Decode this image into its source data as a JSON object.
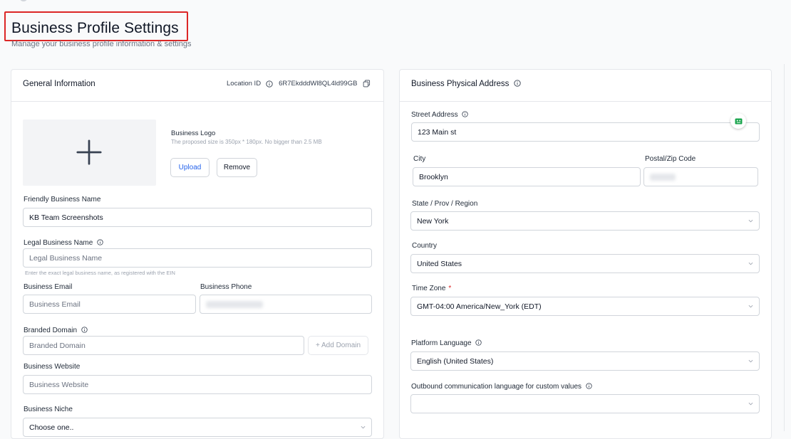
{
  "page": {
    "title": "Business Profile Settings",
    "subtitle": "Manage your business profile information & settings"
  },
  "general": {
    "title": "General Information",
    "location_label": "Location ID",
    "location_id": "6R7EkdddWl8QL4ld99GB",
    "logo_label": "Business Logo",
    "logo_hint": "The proposed size is 350px * 180px. No bigger than 2.5 MB",
    "upload_label": "Upload",
    "remove_label": "Remove",
    "friendly_name_label": "Friendly Business Name",
    "friendly_name_value": "KB Team Screenshots",
    "legal_name_label": "Legal Business Name",
    "legal_name_placeholder": "Legal Business Name",
    "legal_name_hint": "Enter the exact legal business name, as registered with the EIN",
    "email_label": "Business Email",
    "email_placeholder": "Business Email",
    "phone_label": "Business Phone",
    "domain_label": "Branded Domain",
    "domain_placeholder": "Branded Domain",
    "add_domain_label": "+ Add Domain",
    "website_label": "Business Website",
    "website_placeholder": "Business Website",
    "niche_label": "Business Niche",
    "niche_value": "Choose one.."
  },
  "address": {
    "title": "Business Physical Address",
    "street_label": "Street Address",
    "street_value": "123 Main st",
    "city_label": "City",
    "city_value": "Brooklyn",
    "postal_label": "Postal/Zip Code",
    "state_label": "State / Prov / Region",
    "state_value": "New York",
    "country_label": "Country",
    "country_value": "United States",
    "timezone_label": "Time Zone",
    "timezone_required": "*",
    "timezone_value": "GMT-04:00 America/New_York (EDT)",
    "platform_language_label": "Platform Language",
    "platform_language_value": "English (United States)",
    "outbound_language_label": "Outbound communication language for custom values",
    "outbound_language_value": ""
  },
  "colors": {
    "accent": "#2563eb",
    "highlight_border": "#dc2626",
    "required": "#dc2626",
    "badge_green": "#16a34a"
  },
  "icons": [
    "plus-icon",
    "info-icon",
    "copy-icon",
    "chevron-down-icon",
    "chat-widget-icon"
  ]
}
